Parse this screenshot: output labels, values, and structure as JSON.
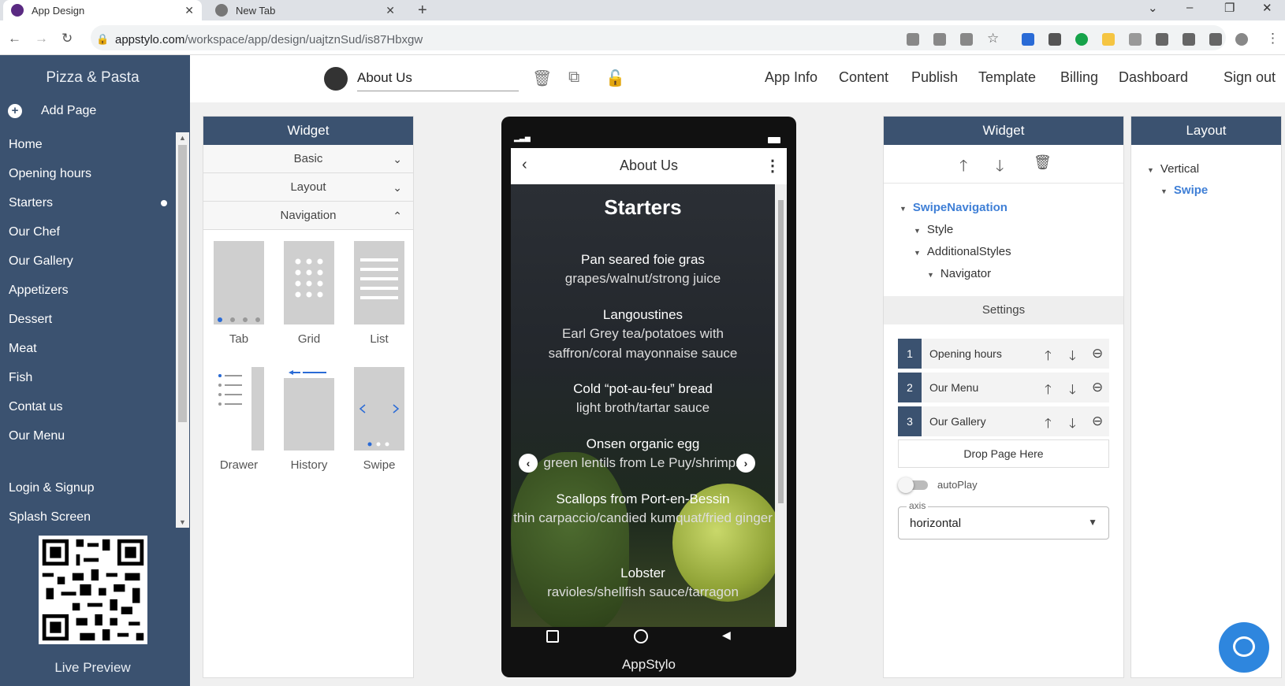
{
  "browser": {
    "tabs": [
      {
        "title": "App Design",
        "active": true
      },
      {
        "title": "New Tab",
        "active": false
      }
    ],
    "url_host": "appstylo.com",
    "url_path": "/workspace/app/design/uajtznSud/is87Hbxgw"
  },
  "sidebar": {
    "app_name": "Pizza & Pasta",
    "add_page_label": "Add Page",
    "pages": [
      "Home",
      "Opening hours",
      "Starters",
      "Our Chef",
      "Our Gallery",
      "Appetizers",
      "Dessert",
      "Meat",
      "Fish",
      "Contat us",
      "Our Menu"
    ],
    "extra_pages": [
      "Login & Signup",
      "Splash Screen"
    ],
    "live_preview_label": "Live Preview"
  },
  "toolbar": {
    "page_name": "About Us",
    "nav": [
      "App Info",
      "Content",
      "Publish",
      "Template",
      "Billing",
      "Dashboard",
      "Sign out"
    ]
  },
  "widget_panel": {
    "title": "Widget",
    "sections": [
      "Basic",
      "Layout",
      "Navigation"
    ],
    "navigation_widgets": [
      "Tab",
      "Grid",
      "List",
      "Drawer",
      "History",
      "Swipe"
    ]
  },
  "phone": {
    "header_title": "About Us",
    "section_title": "Starters",
    "items": [
      {
        "name": "Pan seared foie gras",
        "desc": "grapes/walnut/strong juice"
      },
      {
        "name": "Langoustines",
        "desc": "Earl Grey tea/potatoes with saffron/coral mayonnaise sauce"
      },
      {
        "name": "Cold “pot-au-feu” bread",
        "desc": "light broth/tartar sauce"
      },
      {
        "name": "Onsen organic egg",
        "desc": "green lentils from Le Puy/shrimps"
      },
      {
        "name": "Scallops from Port-en-Bessin",
        "desc": "thin carpaccio/candied kumquat/fried ginger"
      },
      {
        "name": "Lobster",
        "desc": "ravioles/shellfish sauce/tarragon"
      }
    ],
    "footer_label": "AppStylo"
  },
  "right_widget": {
    "title": "Widget",
    "tree": [
      "SwipeNavigation",
      "Style",
      "AdditionalStyles",
      "Navigator"
    ],
    "settings_title": "Settings",
    "nav_pages": [
      {
        "num": "1",
        "label": "Opening hours"
      },
      {
        "num": "2",
        "label": "Our Menu"
      },
      {
        "num": "3",
        "label": "Our Gallery"
      }
    ],
    "drop_label": "Drop Page Here",
    "autoplay_label": "autoPlay",
    "axis_label": "axis",
    "axis_value": "horizontal"
  },
  "layout_panel": {
    "title": "Layout",
    "tree": [
      "Vertical",
      "Swipe"
    ]
  },
  "colors": {
    "sidebar": "#3b5270",
    "accent_link": "#3f7fd6"
  }
}
